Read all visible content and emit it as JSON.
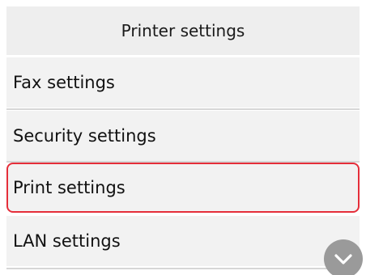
{
  "header": {
    "title": "Printer settings"
  },
  "menu": {
    "items": [
      {
        "label": "Fax settings"
      },
      {
        "label": "Security settings"
      },
      {
        "label": "Print settings",
        "selected": true
      },
      {
        "label": "LAN settings"
      }
    ]
  },
  "controls": {
    "scroll_down_icon": "chevron-down-icon"
  },
  "colors": {
    "selection_border": "#e52e3a",
    "header_bg": "#eeeeee",
    "item_bg": "#f2f2f2",
    "scroll_button_bg": "#9a9a9a"
  }
}
